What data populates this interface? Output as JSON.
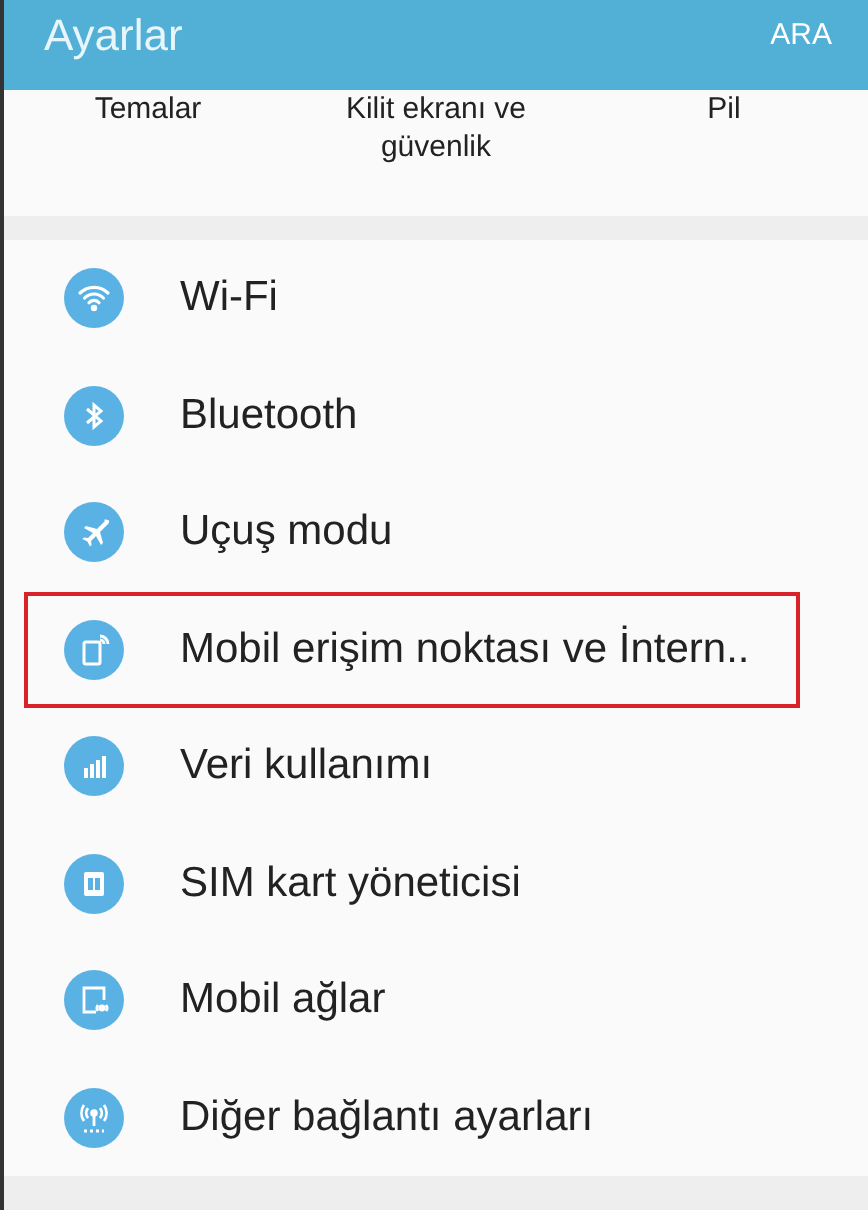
{
  "header": {
    "title": "Ayarlar",
    "action": "ARA"
  },
  "shortcuts": [
    "Temalar",
    "Kilit ekranı ve güvenlik",
    "Pil"
  ],
  "items": [
    {
      "label": "Wi-Fi",
      "highlighted": false
    },
    {
      "label": "Bluetooth",
      "highlighted": false
    },
    {
      "label": "Uçuş modu",
      "highlighted": false
    },
    {
      "label": "Mobil erişim noktası ve İntern..",
      "highlighted": true
    },
    {
      "label": "Veri kullanımı",
      "highlighted": false
    },
    {
      "label": "SIM kart yöneticisi",
      "highlighted": false
    },
    {
      "label": "Mobil ağlar",
      "highlighted": false
    },
    {
      "label": "Diğer bağlantı ayarları",
      "highlighted": false
    }
  ]
}
